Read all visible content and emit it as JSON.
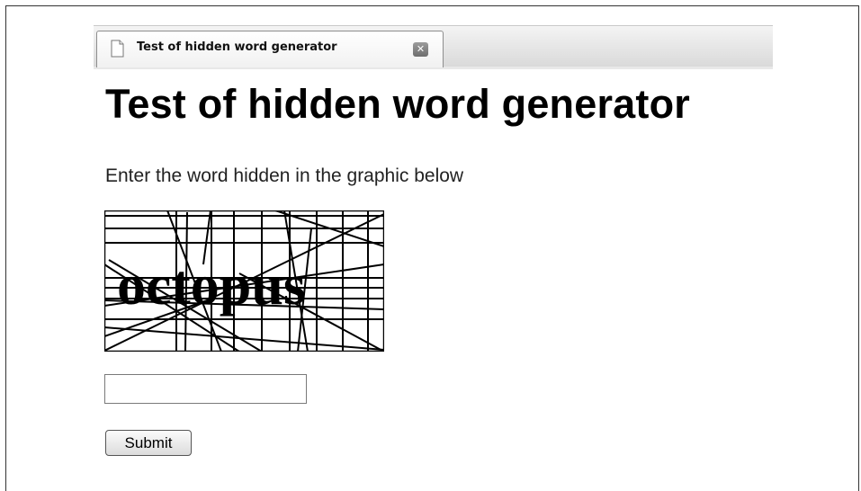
{
  "browser": {
    "tab_title": "Test of hidden word generator",
    "tab_icon": "document-icon",
    "close_icon": "close-icon"
  },
  "page": {
    "heading": "Test of hidden word generator",
    "instructions": "Enter the word hidden in the graphic below",
    "captcha": {
      "word": "octopus",
      "alt": "octopus"
    },
    "answer_input": {
      "value": "",
      "placeholder": ""
    },
    "submit_label": "Submit"
  }
}
